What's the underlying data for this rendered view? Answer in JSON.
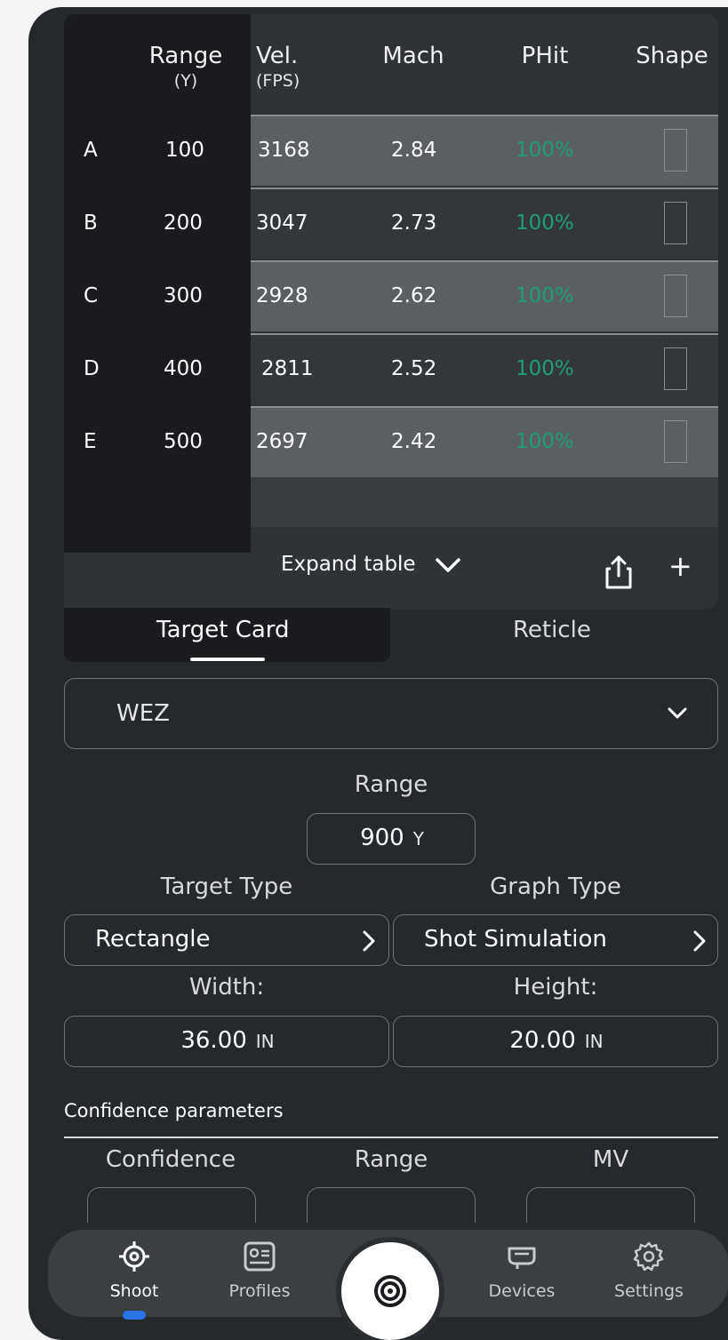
{
  "table": {
    "headers": {
      "range": "Range",
      "range_unit": "(Y)",
      "vel": "Vel.",
      "vel_unit": "(FPS)",
      "mach": "Mach",
      "phit": "PHit",
      "shape": "Shape"
    },
    "rows": [
      {
        "label": "A",
        "range": "100",
        "vel": "3168",
        "mach": "2.84",
        "phit": "100%"
      },
      {
        "label": "B",
        "range": "200",
        "vel": "3047",
        "mach": "2.73",
        "phit": "100%"
      },
      {
        "label": "C",
        "range": "300",
        "vel": "2928",
        "mach": "2.62",
        "phit": "100%"
      },
      {
        "label": "D",
        "range": "400",
        "vel": "2811",
        "mach": "2.52",
        "phit": "100%"
      },
      {
        "label": "E",
        "range": "500",
        "vel": "2697",
        "mach": "2.42",
        "phit": "100%"
      }
    ],
    "expand_label": "Expand table",
    "icons": {
      "expand": "chevron-down-icon",
      "share": "share-icon",
      "add": "plus-icon"
    }
  },
  "tabs": {
    "target_card": "Target Card",
    "reticle": "Reticle",
    "active": "Target Card"
  },
  "form": {
    "mode_select": "WEZ",
    "range_label": "Range",
    "range_value": "900",
    "range_unit": "Y",
    "target_type_label": "Target Type",
    "target_type_value": "Rectangle",
    "graph_type_label": "Graph Type",
    "graph_type_value": "Shot Simulation",
    "width_label": "Width:",
    "width_value": "36.00",
    "width_unit": "IN",
    "height_label": "Height:",
    "height_value": "20.00",
    "height_unit": "IN"
  },
  "confidence": {
    "title": "Confidence parameters",
    "col_confidence": "Confidence",
    "col_range": "Range",
    "col_mv": "MV"
  },
  "nav": {
    "shoot": "Shoot",
    "profiles": "Profiles",
    "devices": "Devices",
    "settings": "Settings",
    "active": "Shoot"
  },
  "colors": {
    "background": "#25282c",
    "phit_green": "#1e9e73",
    "active_indicator": "#2c73e8"
  }
}
